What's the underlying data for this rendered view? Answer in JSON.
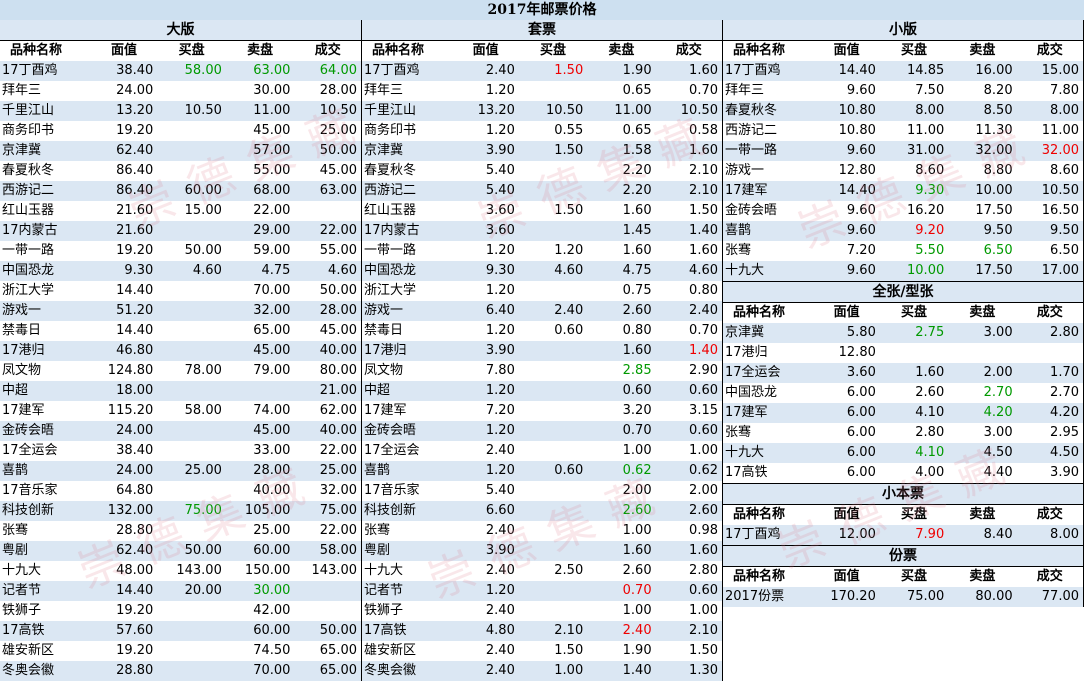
{
  "title": "2017年邮票价格",
  "headers": [
    "品种名称",
    "面值",
    "买盘",
    "卖盘",
    "成交"
  ],
  "watermark": "崇德集藏",
  "colors": {
    "header_band": "#dbe7f3",
    "up": "#009900",
    "down": "#ee0000"
  },
  "sections": {
    "daban": {
      "title": "大版",
      "rows": [
        [
          "17丁酉鸡",
          "38.40",
          "58.00",
          "63.00",
          "64.00"
        ],
        [
          "拜年三",
          "24.00",
          "",
          "30.00",
          "28.00"
        ],
        [
          "千里江山",
          "13.20",
          "10.50",
          "11.00",
          "10.50"
        ],
        [
          "商务印书",
          "19.20",
          "",
          "45.00",
          "25.00"
        ],
        [
          "京津冀",
          "62.40",
          "",
          "57.00",
          "50.00"
        ],
        [
          "春夏秋冬",
          "86.40",
          "",
          "55.00",
          "45.00"
        ],
        [
          "西游记二",
          "86.40",
          "60.00",
          "68.00",
          "63.00"
        ],
        [
          "红山玉器",
          "21.60",
          "15.00",
          "22.00",
          ""
        ],
        [
          "17内蒙古",
          "21.60",
          "",
          "29.00",
          "22.00"
        ],
        [
          "一带一路",
          "19.20",
          "50.00",
          "59.00",
          "55.00"
        ],
        [
          "中国恐龙",
          "9.30",
          "4.60",
          "4.75",
          "4.60"
        ],
        [
          "浙江大学",
          "14.40",
          "",
          "70.00",
          "50.00"
        ],
        [
          "游戏一",
          "51.20",
          "",
          "32.00",
          "28.00"
        ],
        [
          "禁毒日",
          "14.40",
          "",
          "65.00",
          "45.00"
        ],
        [
          "17港归",
          "46.80",
          "",
          "45.00",
          "40.00"
        ],
        [
          "凤文物",
          "124.80",
          "78.00",
          "79.00",
          "80.00"
        ],
        [
          "中超",
          "18.00",
          "",
          "",
          "21.00"
        ],
        [
          "17建军",
          "115.20",
          "58.00",
          "74.00",
          "62.00"
        ],
        [
          "金砖会晤",
          "24.00",
          "",
          "45.00",
          "40.00"
        ],
        [
          "17全运会",
          "38.40",
          "",
          "33.00",
          "22.00"
        ],
        [
          "喜鹊",
          "24.00",
          "25.00",
          "28.00",
          "25.00"
        ],
        [
          "17音乐家",
          "64.80",
          "",
          "40.00",
          "32.00"
        ],
        [
          "科技创新",
          "132.00",
          "75.00",
          "105.00",
          "75.00"
        ],
        [
          "张骞",
          "28.80",
          "",
          "25.00",
          "22.00"
        ],
        [
          "粤剧",
          "62.40",
          "50.00",
          "60.00",
          "58.00"
        ],
        [
          "十九大",
          "48.00",
          "143.00",
          "150.00",
          "143.00"
        ],
        [
          "记者节",
          "14.40",
          "20.00",
          "30.00",
          ""
        ],
        [
          "铁狮子",
          "19.20",
          "",
          "42.00",
          ""
        ],
        [
          "17高铁",
          "57.60",
          "",
          "60.00",
          "50.00"
        ],
        [
          "雄安新区",
          "19.20",
          "",
          "74.50",
          "65.00"
        ],
        [
          "冬奥会徽",
          "28.80",
          "",
          "70.00",
          "65.00"
        ]
      ]
    },
    "taopiao": {
      "title": "套票",
      "rows": [
        [
          "17丁酉鸡",
          "2.40",
          "1.50",
          "1.90",
          "1.60"
        ],
        [
          "拜年三",
          "1.20",
          "",
          "0.65",
          "0.70"
        ],
        [
          "千里江山",
          "13.20",
          "10.50",
          "11.00",
          "10.50"
        ],
        [
          "商务印书",
          "1.20",
          "0.55",
          "0.65",
          "0.58"
        ],
        [
          "京津冀",
          "3.90",
          "1.50",
          "1.58",
          "1.60"
        ],
        [
          "春夏秋冬",
          "5.40",
          "",
          "2.20",
          "2.10"
        ],
        [
          "西游记二",
          "5.40",
          "",
          "2.20",
          "2.10"
        ],
        [
          "红山玉器",
          "3.60",
          "1.50",
          "1.60",
          "1.50"
        ],
        [
          "17内蒙古",
          "3.60",
          "",
          "1.45",
          "1.40"
        ],
        [
          "一带一路",
          "1.20",
          "1.20",
          "1.60",
          "1.60"
        ],
        [
          "中国恐龙",
          "9.30",
          "4.60",
          "4.75",
          "4.60"
        ],
        [
          "浙江大学",
          "1.20",
          "",
          "0.75",
          "0.80"
        ],
        [
          "游戏一",
          "6.40",
          "2.40",
          "2.60",
          "2.40"
        ],
        [
          "禁毒日",
          "1.20",
          "0.60",
          "0.80",
          "0.70"
        ],
        [
          "17港归",
          "3.90",
          "",
          "1.60",
          "1.40"
        ],
        [
          "凤文物",
          "7.80",
          "",
          "2.85",
          "2.90"
        ],
        [
          "中超",
          "1.20",
          "",
          "0.60",
          "0.60"
        ],
        [
          "17建军",
          "7.20",
          "",
          "3.20",
          "3.15"
        ],
        [
          "金砖会晤",
          "1.20",
          "",
          "0.70",
          "0.60"
        ],
        [
          "17全运会",
          "2.40",
          "",
          "1.00",
          "1.00"
        ],
        [
          "喜鹊",
          "1.20",
          "0.60",
          "0.62",
          "0.62"
        ],
        [
          "17音乐家",
          "5.40",
          "",
          "2.00",
          "2.00"
        ],
        [
          "科技创新",
          "6.60",
          "",
          "2.60",
          "2.60"
        ],
        [
          "张骞",
          "2.40",
          "",
          "1.00",
          "0.98"
        ],
        [
          "粤剧",
          "3.90",
          "",
          "1.60",
          "1.60"
        ],
        [
          "十九大",
          "2.40",
          "2.50",
          "2.60",
          "2.80"
        ],
        [
          "记者节",
          "1.20",
          "",
          "0.70",
          "0.60"
        ],
        [
          "铁狮子",
          "2.40",
          "",
          "1.00",
          "1.00"
        ],
        [
          "17高铁",
          "4.80",
          "2.10",
          "2.40",
          "2.10"
        ],
        [
          "雄安新区",
          "2.40",
          "1.50",
          "1.90",
          "1.50"
        ],
        [
          "冬奥会徽",
          "2.40",
          "1.00",
          "1.40",
          "1.30"
        ]
      ]
    },
    "xiaoban": {
      "title": "小版",
      "rows": [
        [
          "17丁酉鸡",
          "14.40",
          "14.85",
          "16.00",
          "15.00"
        ],
        [
          "拜年三",
          "9.60",
          "7.50",
          "8.20",
          "7.80"
        ],
        [
          "春夏秋冬",
          "10.80",
          "8.00",
          "8.50",
          "8.00"
        ],
        [
          "西游记二",
          "10.80",
          "11.00",
          "11.30",
          "11.00"
        ],
        [
          "一带一路",
          "9.60",
          "31.00",
          "32.00",
          "32.00"
        ],
        [
          "游戏一",
          "12.80",
          "8.60",
          "8.80",
          "8.60"
        ],
        [
          "17建军",
          "14.40",
          "9.30",
          "10.00",
          "10.50"
        ],
        [
          "金砖会晤",
          "9.60",
          "16.20",
          "17.50",
          "16.50"
        ],
        [
          "喜鹊",
          "9.60",
          "9.20",
          "9.50",
          "9.50"
        ],
        [
          "张骞",
          "7.20",
          "5.50",
          "6.50",
          "6.50"
        ],
        [
          "十九大",
          "9.60",
          "10.00",
          "17.50",
          "17.00"
        ]
      ]
    },
    "quanzhang": {
      "title": "全张/型张",
      "rows": [
        [
          "京津冀",
          "5.80",
          "2.75",
          "3.00",
          "2.80"
        ],
        [
          "17港归",
          "12.80",
          "",
          "",
          ""
        ],
        [
          "17全运会",
          "3.60",
          "1.60",
          "2.00",
          "1.70"
        ],
        [
          "中国恐龙",
          "6.00",
          "2.60",
          "2.70",
          "2.70"
        ],
        [
          "17建军",
          "6.00",
          "4.10",
          "4.20",
          "4.20"
        ],
        [
          "张骞",
          "6.00",
          "2.80",
          "3.00",
          "2.95"
        ],
        [
          "十九大",
          "6.00",
          "4.10",
          "4.50",
          "4.50"
        ],
        [
          "17高铁",
          "6.00",
          "4.00",
          "4.40",
          "3.90"
        ]
      ]
    },
    "xiaobenpiao": {
      "title": "小本票",
      "rows": [
        [
          "17丁酉鸡",
          "12.00",
          "7.90",
          "8.40",
          "8.00"
        ]
      ]
    },
    "fenpiao": {
      "title": "份票",
      "rows": [
        [
          "2017份票",
          "170.20",
          "75.00",
          "80.00",
          "77.00"
        ]
      ]
    }
  },
  "highlights": {
    "daban": [
      [
        0,
        2,
        "green"
      ],
      [
        0,
        3,
        "green"
      ],
      [
        0,
        4,
        "green"
      ],
      [
        22,
        2,
        "green"
      ],
      [
        26,
        3,
        "green"
      ]
    ],
    "taopiao": [
      [
        0,
        2,
        "red"
      ],
      [
        14,
        4,
        "red"
      ],
      [
        15,
        3,
        "green"
      ],
      [
        20,
        3,
        "green"
      ],
      [
        22,
        3,
        "green"
      ],
      [
        26,
        3,
        "red"
      ],
      [
        28,
        3,
        "red"
      ]
    ],
    "xiaoban": [
      [
        4,
        4,
        "red"
      ],
      [
        6,
        2,
        "green"
      ],
      [
        8,
        2,
        "red"
      ],
      [
        9,
        2,
        "green"
      ],
      [
        9,
        3,
        "green"
      ],
      [
        10,
        2,
        "green"
      ]
    ],
    "quanzhang": [
      [
        0,
        2,
        "green"
      ],
      [
        3,
        3,
        "green"
      ],
      [
        4,
        3,
        "green"
      ],
      [
        6,
        2,
        "green"
      ]
    ],
    "xiaobenpiao": [
      [
        0,
        2,
        "red"
      ]
    ],
    "fenpiao": []
  }
}
